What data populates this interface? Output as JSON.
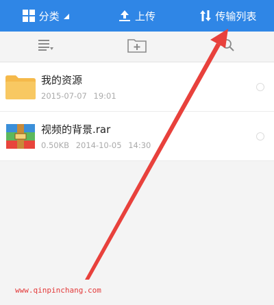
{
  "topbar": {
    "category_label": "分类",
    "upload_label": "上传",
    "transfer_label": "传输列表"
  },
  "files": [
    {
      "name": "我的资源",
      "size": "",
      "date": "2015-07-07",
      "time": "19:01",
      "icon": "folder-icon"
    },
    {
      "name": "视频的背景.rar",
      "size": "0.50KB",
      "date": "2014-10-05",
      "time": "14:30",
      "icon": "rar-archive-icon"
    }
  ],
  "watermark": "www.qinpinchang.com",
  "colors": {
    "topbar": "#2f86e6",
    "annotation_arrow": "#e8413c",
    "folder": "#f5b94a"
  }
}
